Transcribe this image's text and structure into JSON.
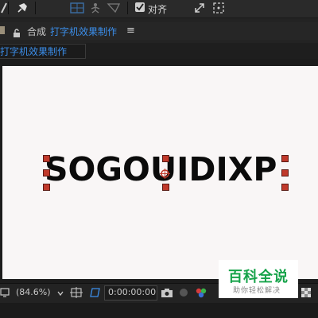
{
  "toolbar": {
    "align_label": "对齐",
    "align_checked": true
  },
  "panel": {
    "label": "合成",
    "composition_name": "打字机效果制作",
    "menu_glyph": "≡"
  },
  "tab": {
    "label": "打字机效果制作"
  },
  "canvas": {
    "text": "SOGOUIDIXP"
  },
  "bottom": {
    "zoom": "(84.6%)",
    "timecode": "0:00:00:00"
  },
  "watermark": {
    "title": "百科全说",
    "subtitle": "助你轻松解决"
  },
  "colors": {
    "accent": "#3b8eea",
    "handle": "#c0392b",
    "watermark_green": "#16a34a"
  }
}
